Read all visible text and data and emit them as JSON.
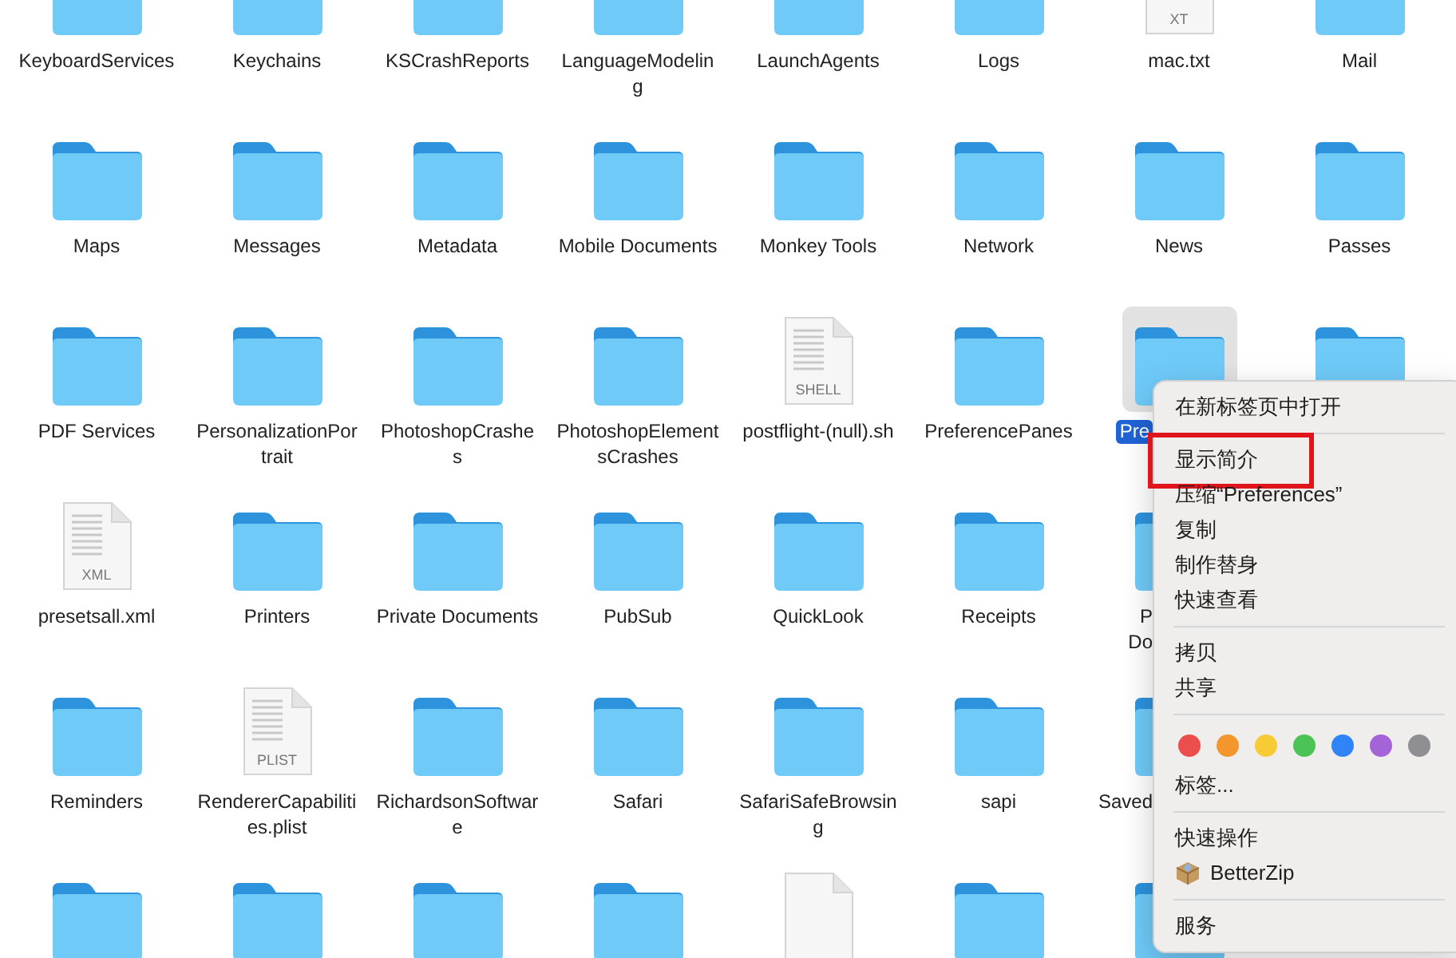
{
  "grid": {
    "rows": [
      [
        {
          "kind": "folder",
          "label": "KeyboardServices"
        },
        {
          "kind": "folder",
          "label": "Keychains"
        },
        {
          "kind": "folder",
          "label": "KSCrashReports"
        },
        {
          "kind": "folder",
          "label": "LanguageModeling"
        },
        {
          "kind": "folder",
          "label": "LaunchAgents"
        },
        {
          "kind": "folder",
          "label": "Logs"
        },
        {
          "kind": "file",
          "label": "mac.txt",
          "badge": "XT"
        },
        {
          "kind": "folder",
          "label": "Mail"
        }
      ],
      [
        {
          "kind": "folder",
          "label": "Maps"
        },
        {
          "kind": "folder",
          "label": "Messages"
        },
        {
          "kind": "folder",
          "label": "Metadata"
        },
        {
          "kind": "folder",
          "label": "Mobile Documents"
        },
        {
          "kind": "folder",
          "label": "Monkey Tools"
        },
        {
          "kind": "folder",
          "label": "Network"
        },
        {
          "kind": "folder",
          "label": "News"
        },
        {
          "kind": "folder",
          "label": "Passes"
        }
      ],
      [
        {
          "kind": "folder",
          "label": "PDF Services"
        },
        {
          "kind": "folder",
          "label": "PersonalizationPortrait"
        },
        {
          "kind": "folder",
          "label": "PhotoshopCrashes"
        },
        {
          "kind": "folder",
          "label": "PhotoshopElementsCrashes"
        },
        {
          "kind": "file",
          "label": "postflight-(null).sh",
          "badge": "SHELL"
        },
        {
          "kind": "folder",
          "label": "PreferencePanes"
        },
        {
          "kind": "folder",
          "label": "Pre",
          "selected": true,
          "clipped": true
        },
        {
          "kind": "folder",
          "selected": false
        }
      ],
      [
        {
          "kind": "file",
          "label": "presetsall.xml",
          "badge": "XML"
        },
        {
          "kind": "folder",
          "label": "Printers"
        },
        {
          "kind": "folder",
          "label": "Private Documents"
        },
        {
          "kind": "folder",
          "label": "PubSub"
        },
        {
          "kind": "folder",
          "label": "QuickLook"
        },
        {
          "kind": "folder",
          "label": "Receipts"
        },
        {
          "kind": "folder",
          "label": "P\nDo",
          "clipped": true
        }
      ],
      [
        {
          "kind": "folder",
          "label": "Reminders"
        },
        {
          "kind": "file",
          "label": "RendererCapabilities.plist",
          "badge": "PLIST"
        },
        {
          "kind": "folder",
          "label": "RichardsonSoftware"
        },
        {
          "kind": "folder",
          "label": "Safari"
        },
        {
          "kind": "folder",
          "label": "SafariSafeBrowsing"
        },
        {
          "kind": "folder",
          "label": "sapi"
        },
        {
          "kind": "folder",
          "label": "Saved",
          "clipped": true
        }
      ],
      [
        {
          "kind": "folder"
        },
        {
          "kind": "folder"
        },
        {
          "kind": "folder"
        },
        {
          "kind": "folder"
        },
        {
          "kind": "file"
        },
        {
          "kind": "folder"
        },
        {
          "kind": "folder"
        }
      ]
    ]
  },
  "context_menu": {
    "items": [
      {
        "kind": "item",
        "label": "在新标签页中打开"
      },
      {
        "kind": "separator"
      },
      {
        "kind": "item",
        "label": "显示简介",
        "highlighted": true
      },
      {
        "kind": "item",
        "label": "压缩“Preferences”"
      },
      {
        "kind": "item",
        "label": "复制"
      },
      {
        "kind": "item",
        "label": "制作替身"
      },
      {
        "kind": "item",
        "label": "快速查看"
      },
      {
        "kind": "separator"
      },
      {
        "kind": "item",
        "label": "拷贝"
      },
      {
        "kind": "item",
        "label": "共享"
      },
      {
        "kind": "separator"
      },
      {
        "kind": "colors",
        "dots": [
          {
            "color": "#ec4f4b"
          },
          {
            "color": "#f3962d"
          },
          {
            "color": "#f7cb35"
          },
          {
            "color": "#4bc355"
          },
          {
            "color": "#2f85f7"
          },
          {
            "color": "#a463d7"
          },
          {
            "color": "#8e8e93"
          }
        ]
      },
      {
        "kind": "item",
        "label": "标签..."
      },
      {
        "kind": "separator"
      },
      {
        "kind": "item",
        "label": "快速操作"
      },
      {
        "kind": "app",
        "label": "BetterZip"
      },
      {
        "kind": "separator"
      },
      {
        "kind": "item",
        "label": "服务"
      }
    ]
  }
}
